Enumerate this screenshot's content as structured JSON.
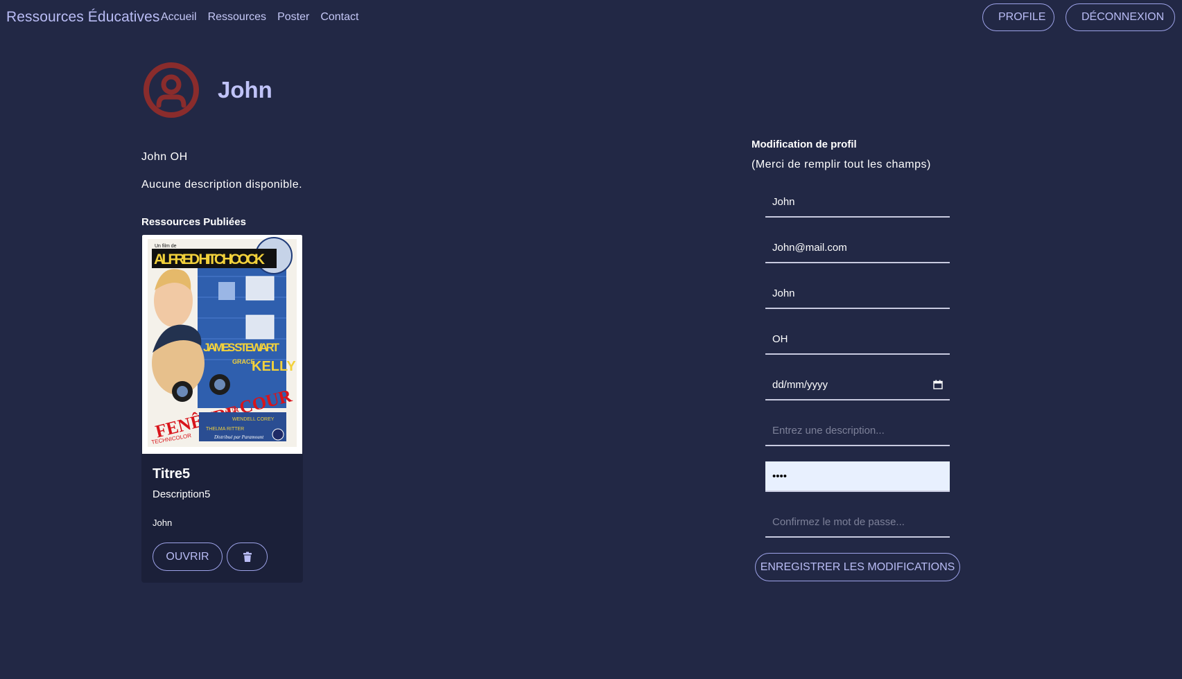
{
  "navbar": {
    "brand": "Ressources Éducatives",
    "links": [
      "Accueil",
      "Ressources",
      "Poster",
      "Contact"
    ],
    "profile_button": "Profile",
    "logout_button": "Déconnexion"
  },
  "profile": {
    "username": "John",
    "fullname": "John OH",
    "description": "Aucune description disponible.",
    "avatar_icon": "user-circle-icon",
    "avatar_color": "#8a2c2c"
  },
  "resources": {
    "section_title": "Ressources Publiées",
    "items": [
      {
        "title": "Titre5",
        "description": "Description5",
        "author": "John",
        "open_label": "Ouvrir",
        "delete_icon": "trash-icon",
        "poster": {
          "top_small": "Un film de",
          "director": "ALFRED HITCHCOCK",
          "actor1": "JAMES STEWART",
          "actor2_prefix": "GRACE",
          "actor2": "KELLY",
          "title_part1": "FENÊTRE",
          "title_part2": "SUR",
          "title_part3": "COUR",
          "color_tag": "TECHNICOLOR",
          "extra1": "WENDELL COREY",
          "extra2": "THELMA RITTER",
          "distributor": "Distribué par Paramount"
        }
      }
    ]
  },
  "form": {
    "title": "Modification de profil",
    "subtitle": "(Merci de remplir tout les champs)",
    "username_value": "John",
    "email_value": "John@mail.com",
    "firstname_value": "John",
    "lastname_value": "OH",
    "date_placeholder": "dd/mm/yyyy",
    "description_placeholder": "Entrez une description...",
    "password_value": "••••",
    "confirm_placeholder": "Confirmez le mot de passe...",
    "save_label": "Enregistrer les modifications"
  }
}
